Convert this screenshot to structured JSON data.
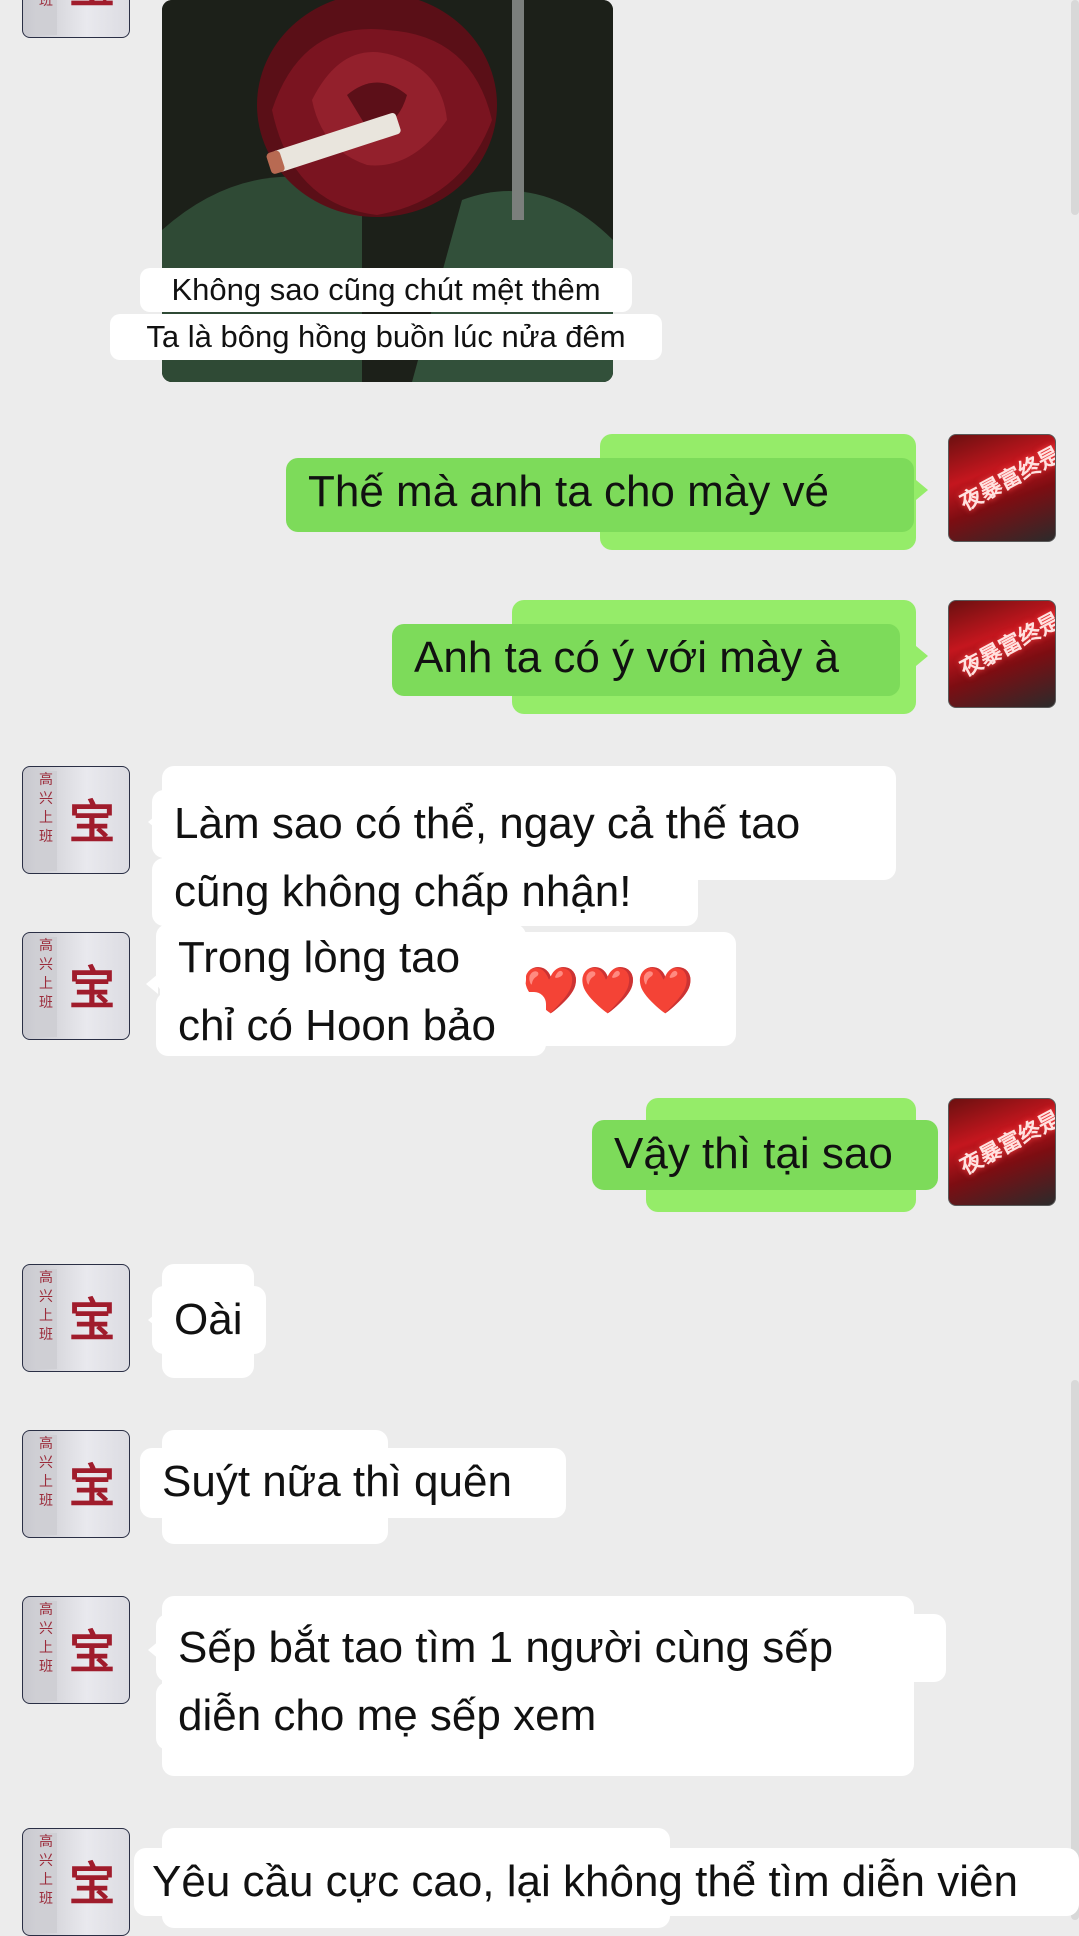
{
  "chat": {
    "image_message": {
      "caption_line1": "Không sao cũng chút mệt thêm",
      "caption_line2": "Ta là bông hồng buồn lúc nửa đêm"
    },
    "messages": [
      {
        "from": "me",
        "text": "Thế mà anh ta cho mày vé"
      },
      {
        "from": "me",
        "text": "Anh ta có ý với mày à"
      },
      {
        "from": "other",
        "line1": "Làm sao có thể, ngay cả thế tao",
        "line2": "cũng không chấp nhận!"
      },
      {
        "from": "other",
        "line1": "Trong lòng tao",
        "line2": "chỉ có Hoon bảo",
        "emoji": "❤️❤️❤️"
      },
      {
        "from": "me",
        "text": "Vậy thì tại sao"
      },
      {
        "from": "other",
        "text": "Oài"
      },
      {
        "from": "other",
        "text": "Suýt nữa thì quên"
      },
      {
        "from": "other",
        "line1": "Sếp bắt tao tìm 1 người cùng sếp",
        "line2": "diễn cho mẹ sếp xem"
      },
      {
        "from": "other",
        "text": "Yêu cầu cực cao, lại không thể tìm diễn viên"
      }
    ]
  },
  "avatars": {
    "other": {
      "column_text": "高兴上班",
      "big_char": "宝",
      "icon": "sign-avatar"
    },
    "me": {
      "neon_text": "夜暴富终是梦",
      "icon": "neon-sign-avatar"
    }
  },
  "colors": {
    "background": "#ececec",
    "bubble_in": "#ffffff",
    "bubble_out": "#95ec69"
  }
}
